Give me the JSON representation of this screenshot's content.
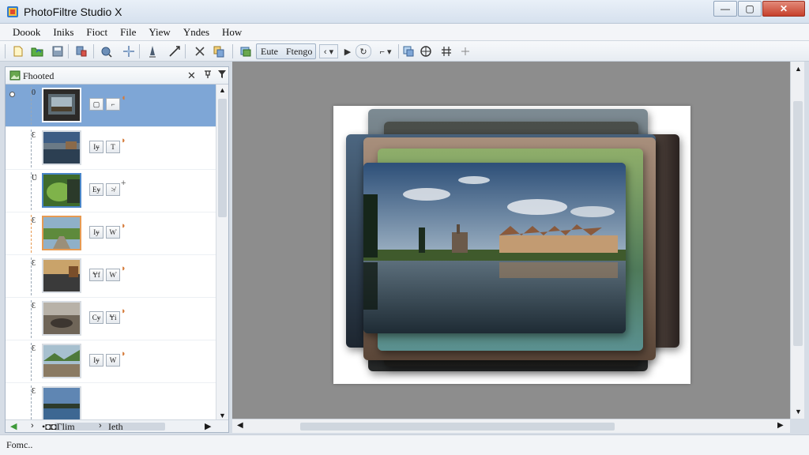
{
  "window": {
    "title": "PhotoFiltre Studio X",
    "min_glyph": "—",
    "max_glyph": "▢",
    "close_glyph": "✕"
  },
  "menu": [
    "Doook",
    "Iniks",
    "Fioct",
    "File",
    "Yiew",
    "Yndes",
    "How"
  ],
  "toolbar": {
    "group_labels": [
      "Eute",
      "Ftengo"
    ],
    "nav_left": "‹ ▾",
    "nav_play": "▶",
    "nav_loop": "↻",
    "nav_corner": "⌐ ▾"
  },
  "panel": {
    "title": "Fhooted",
    "close_glyph": "✕",
    "rows": [
      {
        "num": "0",
        "b1": "▢",
        "b2": "⌐",
        "mark": "◖"
      },
      {
        "num": "Ɛ",
        "b1": "Iɏ",
        "b2": "T",
        "mark": "◗"
      },
      {
        "num": "Ʋ",
        "b1": "Eɏ",
        "b2": "≯",
        "mark": "+"
      },
      {
        "num": "Ɛ",
        "b1": "Iɏ",
        "b2": "Ⱳ",
        "mark": "◗"
      },
      {
        "num": "Ɛ",
        "b1": "Ɏf",
        "b2": "Ⱳ",
        "mark": "◗"
      },
      {
        "num": "Ɛ",
        "b1": "Cɏ",
        "b2": "Ɏi",
        "mark": "◗"
      },
      {
        "num": "Ɛ",
        "b1": "Iɏ",
        "b2": "W",
        "mark": "◗"
      },
      {
        "num": "Ɛ",
        "b1": "",
        "b2": "",
        "mark": ""
      }
    ]
  },
  "left_bottombar": {
    "label_mid": "•◘◘Гlim",
    "label_right": "Ieth"
  },
  "status": {
    "text": "Fomc.."
  }
}
